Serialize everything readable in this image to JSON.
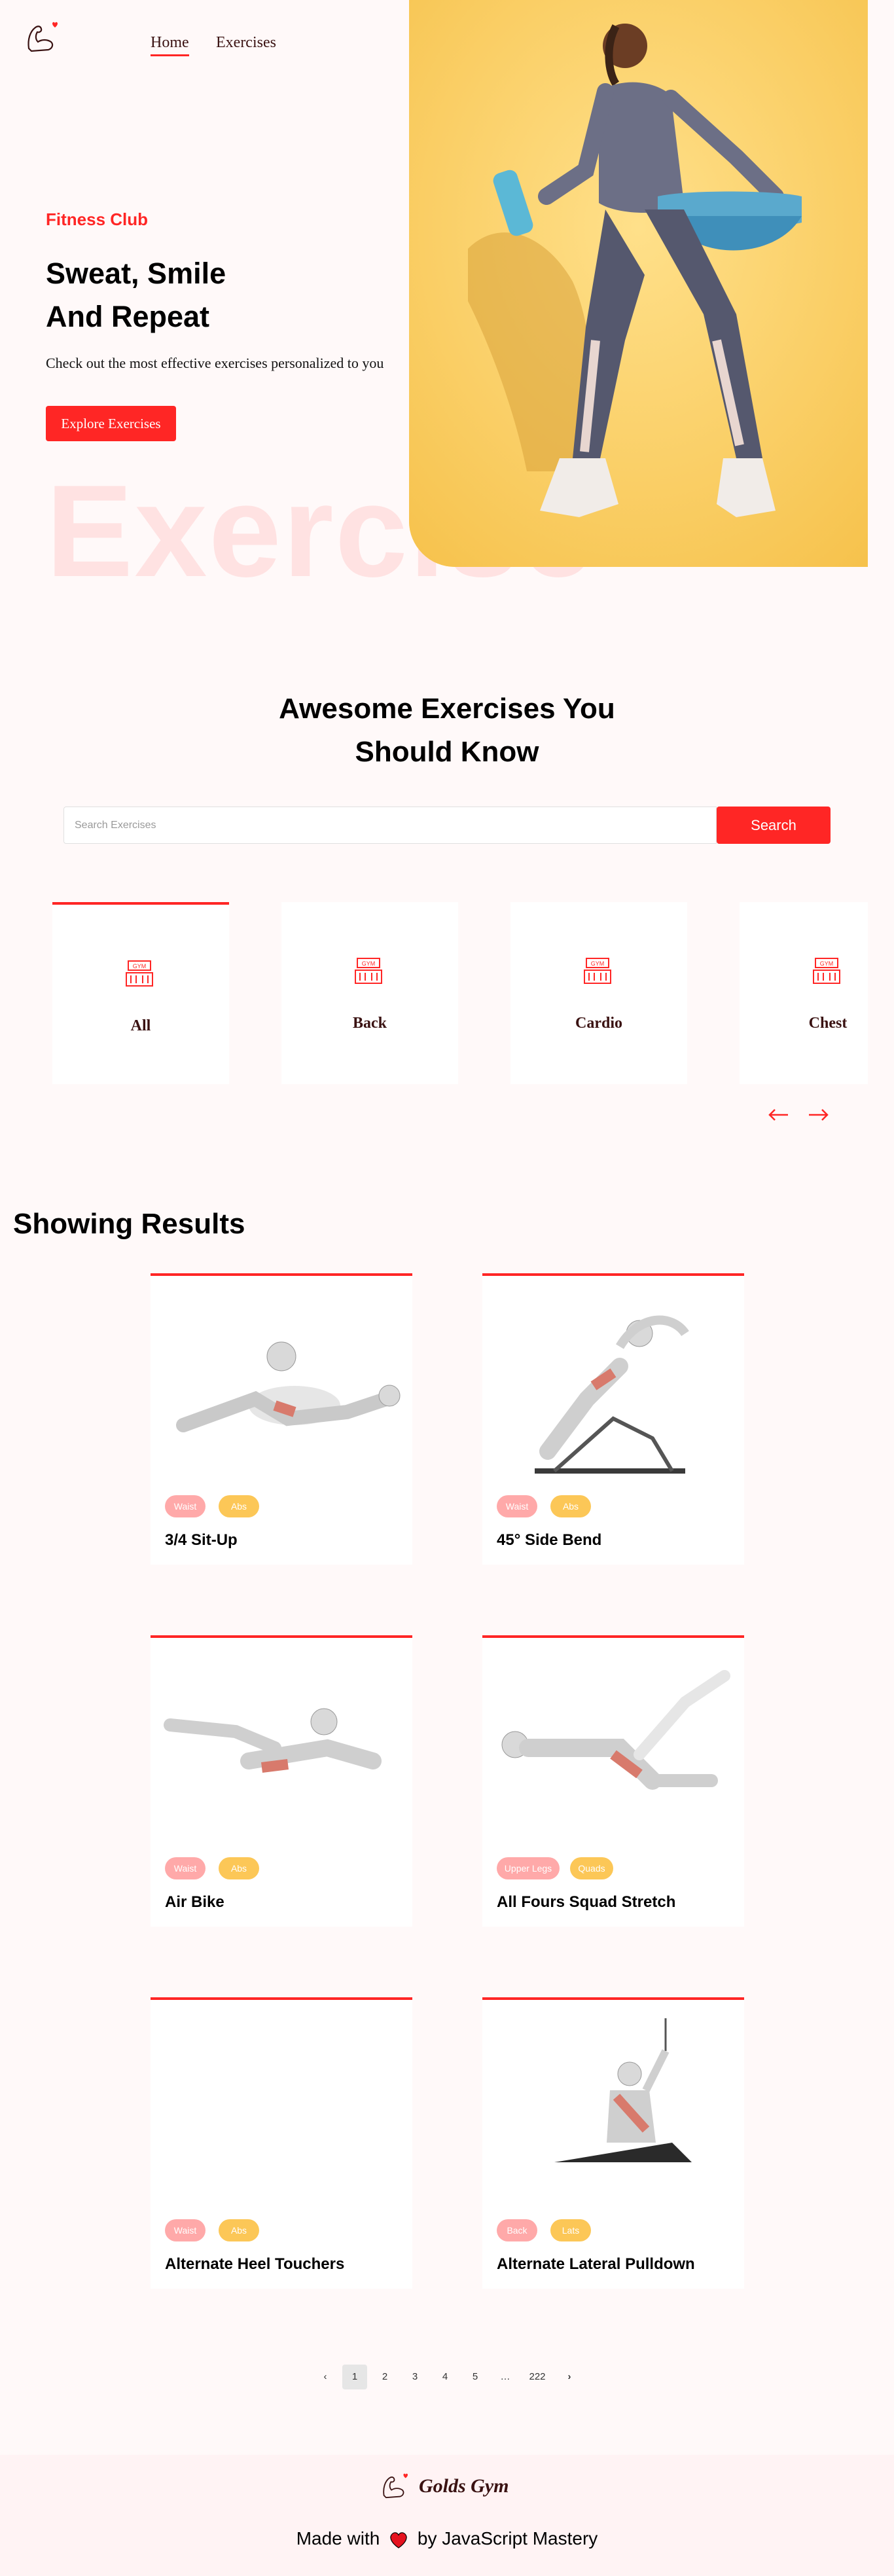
{
  "nav": {
    "home_label": "Home",
    "exercises_label": "Exercises",
    "logo_icon": "flexing-arm-icon"
  },
  "hero": {
    "kicker": "Fitness Club",
    "title_line1": "Sweat, Smile",
    "title_line2": "And Repeat",
    "subtitle": "Check out the most effective exercises personalized to you",
    "button_label": "Explore Exercises",
    "background_word": "Exercise"
  },
  "search": {
    "title_line1": "Awesome Exercises You",
    "title_line2": "Should Know",
    "placeholder": "Search Exercises",
    "button_label": "Search"
  },
  "categories": [
    {
      "label": "All",
      "active": true
    },
    {
      "label": "Back",
      "active": false
    },
    {
      "label": "Cardio",
      "active": false
    },
    {
      "label": "Chest",
      "active": false
    }
  ],
  "results": {
    "title": "Showing Results",
    "exercises": [
      {
        "name": "3/4 Sit-Up",
        "body_part": "Waist",
        "target": "Abs"
      },
      {
        "name": "45° Side Bend",
        "body_part": "Waist",
        "target": "Abs"
      },
      {
        "name": "Air Bike",
        "body_part": "Waist",
        "target": "Abs"
      },
      {
        "name": "All Fours Squad Stretch",
        "body_part": "Upper Legs",
        "target": "Quads"
      },
      {
        "name": "Alternate Heel Touchers",
        "body_part": "Waist",
        "target": "Abs"
      },
      {
        "name": "Alternate Lateral Pulldown",
        "body_part": "Back",
        "target": "Lats"
      }
    ]
  },
  "pagination": {
    "prev": "‹",
    "pages": [
      "1",
      "2",
      "3",
      "4",
      "5"
    ],
    "ellipsis": "…",
    "last": "222",
    "next": "›",
    "current": "1"
  },
  "footer": {
    "brand": "Golds Gym",
    "made_with": "Made with",
    "by": "by JavaScript Mastery"
  },
  "colors": {
    "accent": "#ff2625",
    "pill_body": "#ffa9a9",
    "pill_target": "#fcc757",
    "hero_bg": "#fdd466"
  }
}
